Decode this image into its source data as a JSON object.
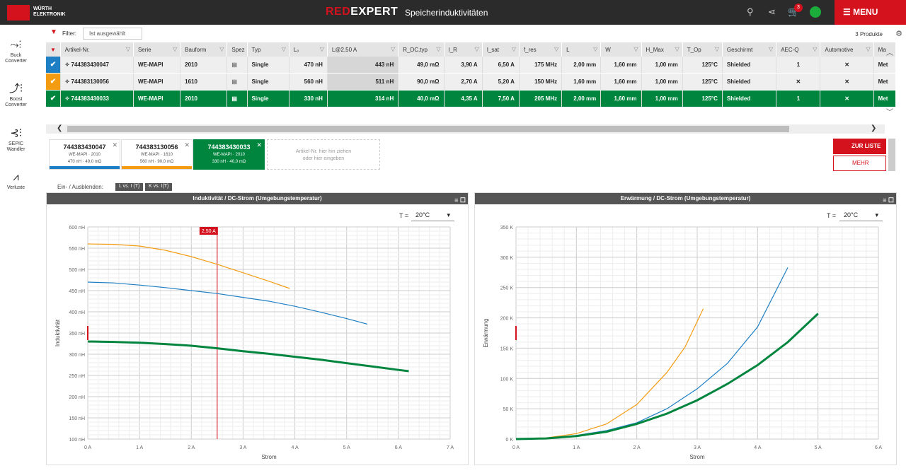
{
  "header": {
    "logo_text": "WÜRTH\nELEKTRONIK",
    "brand_red": "RED",
    "brand_white": "EXPERT",
    "page_title": "Speicherinduktivitäten",
    "cart_count": "3",
    "menu_label": "MENU"
  },
  "sidebar": [
    {
      "label": "Buck\nConverter",
      "icon": "buck-converter-icon"
    },
    {
      "label": "Boost\nConverter",
      "icon": "boost-converter-icon"
    },
    {
      "label": "SEPIC\nWandler",
      "icon": "sepic-icon"
    },
    {
      "label": "Verluste",
      "icon": "losses-icon"
    }
  ],
  "filter": {
    "label": "Filter:",
    "value": "Ist ausgewählt",
    "products": "3 Produkte"
  },
  "table": {
    "columns": [
      "Artikel-Nr.",
      "Serie",
      "Bauform",
      "Spez",
      "Typ",
      "L₀",
      "L@2,50 A",
      "R_DC,typ",
      "I_R",
      "I_sat",
      "f_res",
      "L",
      "W",
      "H_Max",
      "T_Op",
      "Geschirmt",
      "AEC-Q",
      "Automotive",
      "Ma"
    ],
    "rows": [
      {
        "check_color": "#1f7fc4",
        "cells": [
          "744383430047",
          "WE-MAPI",
          "2010",
          "",
          "Single",
          "470 nH",
          "443 nH",
          "49,0 mΩ",
          "3,90 A",
          "6,50 A",
          "175 MHz",
          "2,00 mm",
          "1,60 mm",
          "1,00 mm",
          "125°C",
          "Shielded",
          "1",
          "✕",
          "Met"
        ]
      },
      {
        "check_color": "#f39c12",
        "cells": [
          "744383130056",
          "WE-MAPI",
          "1610",
          "",
          "Single",
          "560 nH",
          "511 nH",
          "90,0 mΩ",
          "2,70 A",
          "5,20 A",
          "150 MHz",
          "1,60 mm",
          "1,60 mm",
          "1,00 mm",
          "125°C",
          "Shielded",
          "✕",
          "✕",
          "Met"
        ]
      },
      {
        "check_color": "#00853f",
        "cells": [
          "744383430033",
          "WE-MAPI",
          "2010",
          "",
          "Single",
          "330 nH",
          "314 nH",
          "40,0 mΩ",
          "4,35 A",
          "7,50 A",
          "205 MHz",
          "2,00 mm",
          "1,60 mm",
          "1,00 mm",
          "125°C",
          "Shielded",
          "1",
          "✕",
          "Met"
        ]
      }
    ]
  },
  "compare": {
    "cards": [
      {
        "number": "744383430047",
        "line1": "WE-MAPI · 2010",
        "line2": "470 nH · 49,0 mΩ",
        "color": "#1f7fc4"
      },
      {
        "number": "744383130056",
        "line1": "WE-MAPI · 1610",
        "line2": "560 nH · 90,0 mΩ",
        "color": "#f39c12"
      },
      {
        "number": "744383430033",
        "line1": "WE-MAPI · 2010",
        "line2": "330 nH · 40,0 mΩ",
        "color": "#00853f"
      }
    ],
    "drop_hint": "Artikel-Nr. hier hin ziehen\noder hier eingeben",
    "zur_liste": "ZUR LISTE",
    "mehr": "MEHR"
  },
  "toggles": {
    "label": "Ein- / Ausblenden:",
    "b1": "L vs. I (T)",
    "b2": "K vs. I(T)"
  },
  "chart_data": [
    {
      "type": "line",
      "title": "Induktivität / DC-Strom (Umgebungstemperatur)",
      "xlabel": "Strom",
      "ylabel": "Induktivität",
      "xlim": [
        0,
        7
      ],
      "ylim": [
        100,
        600
      ],
      "xticks": [
        "0 A",
        "1 A",
        "2 A",
        "3 A",
        "4 A",
        "5 A",
        "6 A",
        "7 A"
      ],
      "yticks": [
        "100 nH",
        "150 nH",
        "200 nH",
        "250 nH",
        "300 nH",
        "350 nH",
        "400 nH",
        "450 nH",
        "500 nH",
        "550 nH",
        "600 nH"
      ],
      "temp_label": "T =",
      "temp_value": "20°C",
      "marker_label": "2,50 A",
      "marker_x": 2.5,
      "series": [
        {
          "color": "#f39c12",
          "width": 1.2,
          "points": [
            [
              0,
              560
            ],
            [
              0.5,
              559
            ],
            [
              1,
              555
            ],
            [
              1.5,
              545
            ],
            [
              2,
              530
            ],
            [
              2.5,
              512
            ],
            [
              3,
              492
            ],
            [
              3.5,
              472
            ],
            [
              3.9,
              455
            ]
          ]
        },
        {
          "color": "#1f7fc4",
          "width": 1.2,
          "points": [
            [
              0,
              470
            ],
            [
              0.5,
              468
            ],
            [
              1,
              463
            ],
            [
              1.5,
              457
            ],
            [
              2,
              450
            ],
            [
              2.5,
              443
            ],
            [
              3,
              434
            ],
            [
              3.5,
              425
            ],
            [
              4,
              413
            ],
            [
              4.5,
              399
            ],
            [
              5,
              384
            ],
            [
              5.4,
              371
            ]
          ]
        },
        {
          "color": "#00853f",
          "width": 3,
          "points": [
            [
              0,
              330
            ],
            [
              0.5,
              329
            ],
            [
              1,
              327
            ],
            [
              1.5,
              324
            ],
            [
              2,
              320
            ],
            [
              2.5,
              314
            ],
            [
              3,
              307
            ],
            [
              3.5,
              301
            ],
            [
              4,
              294
            ],
            [
              4.5,
              287
            ],
            [
              5,
              279
            ],
            [
              5.5,
              271
            ],
            [
              6,
              263
            ],
            [
              6.2,
              260
            ]
          ]
        }
      ]
    },
    {
      "type": "line",
      "title": "Erwärmung / DC-Strom (Umgebungstemperatur)",
      "xlabel": "Strom",
      "ylabel": "Erwärmung",
      "xlim": [
        0,
        6
      ],
      "ylim": [
        0,
        350
      ],
      "xticks": [
        "0 A",
        "1 A",
        "2 A",
        "3 A",
        "4 A",
        "5 A",
        "6 A"
      ],
      "yticks": [
        "0 K",
        "50 K",
        "100 K",
        "150 K",
        "200 K",
        "250 K",
        "300 K",
        "350 K"
      ],
      "temp_label": "T =",
      "temp_value": "20°C",
      "series": [
        {
          "color": "#f39c12",
          "width": 1.2,
          "points": [
            [
              0,
              0
            ],
            [
              0.5,
              2
            ],
            [
              1,
              9
            ],
            [
              1.5,
              25
            ],
            [
              2,
              57
            ],
            [
              2.5,
              110
            ],
            [
              2.8,
              152
            ],
            [
              3.1,
              215
            ]
          ]
        },
        {
          "color": "#1f7fc4",
          "width": 1.2,
          "points": [
            [
              0,
              0
            ],
            [
              0.5,
              1
            ],
            [
              1,
              6
            ],
            [
              1.5,
              14
            ],
            [
              2,
              27
            ],
            [
              2.5,
              50
            ],
            [
              3,
              83
            ],
            [
              3.5,
              125
            ],
            [
              4,
              185
            ],
            [
              4.5,
              283
            ]
          ]
        },
        {
          "color": "#00853f",
          "width": 3,
          "points": [
            [
              0,
              0
            ],
            [
              0.5,
              1
            ],
            [
              1,
              5
            ],
            [
              1.5,
              12
            ],
            [
              2,
              25
            ],
            [
              2.5,
              42
            ],
            [
              3,
              64
            ],
            [
              3.5,
              91
            ],
            [
              4,
              122
            ],
            [
              4.5,
              160
            ],
            [
              5,
              207
            ]
          ]
        }
      ]
    }
  ]
}
